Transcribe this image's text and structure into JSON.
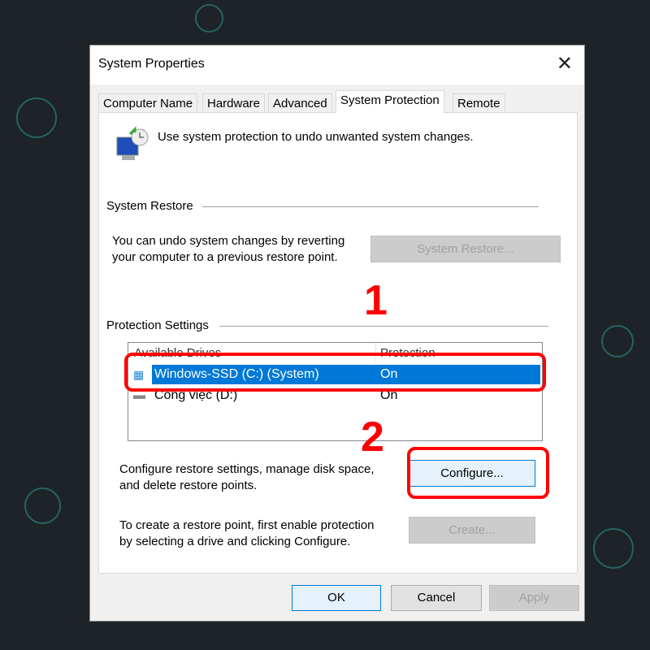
{
  "window": {
    "title": "System Properties"
  },
  "tabs": [
    {
      "label": "Computer Name"
    },
    {
      "label": "Hardware"
    },
    {
      "label": "Advanced"
    },
    {
      "label": "System Protection"
    },
    {
      "label": "Remote"
    }
  ],
  "header": {
    "text": "Use system protection to undo unwanted system changes."
  },
  "system_restore": {
    "group_label": "System Restore",
    "description_line1": "You can undo system changes by reverting",
    "description_line2": "your computer to a previous restore point.",
    "button": "System Restore..."
  },
  "protection": {
    "group_label": "Protection Settings",
    "columns": [
      "Available Drives",
      "Protection"
    ],
    "drives": [
      {
        "name": "Windows-SSD (C:) (System)",
        "protection": "On",
        "selected": true
      },
      {
        "name": "Công việc (D:)",
        "protection": "On",
        "selected": false
      }
    ],
    "configure_line1": "Configure restore settings, manage disk space,",
    "configure_line2": "and delete restore points.",
    "configure_button": "Configure...",
    "create_line1": "To create a restore point, first enable protection",
    "create_line2": "by selecting a drive and clicking Configure.",
    "create_button": "Create..."
  },
  "annotations": [
    "1",
    "2"
  ],
  "footer": {
    "ok": "OK",
    "cancel": "Cancel",
    "apply": "Apply"
  },
  "colors": {
    "selection": "#0078d7",
    "annotation": "#ff0000"
  }
}
